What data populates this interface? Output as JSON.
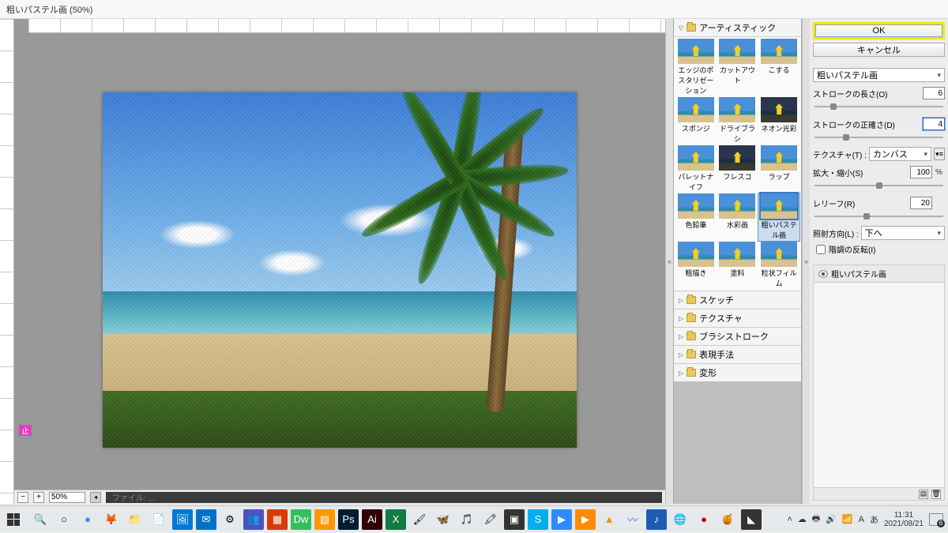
{
  "title": "粗いパステル画 (50%)",
  "zoom": {
    "value": "50%",
    "stop_label": "止"
  },
  "docinfo": "ファイル: ...",
  "categories": {
    "open": "アーティスティック",
    "closed": [
      "スケッチ",
      "テクスチャ",
      "ブラシストローク",
      "表現手法",
      "変形"
    ]
  },
  "thumbs": [
    {
      "label": "エッジのポスタリゼーション",
      "dark": false
    },
    {
      "label": "カットアウト",
      "dark": false
    },
    {
      "label": "こする",
      "dark": false
    },
    {
      "label": "スポンジ",
      "dark": false
    },
    {
      "label": "ドライブラシ",
      "dark": false
    },
    {
      "label": "ネオン光彩",
      "dark": true
    },
    {
      "label": "パレットナイフ",
      "dark": false
    },
    {
      "label": "フレスコ",
      "dark": true
    },
    {
      "label": "ラップ",
      "dark": false
    },
    {
      "label": "色鉛筆",
      "dark": false
    },
    {
      "label": "水彩画",
      "dark": false
    },
    {
      "label": "粗いパステル画",
      "dark": false,
      "selected": true
    },
    {
      "label": "粗描き",
      "dark": false
    },
    {
      "label": "塗料",
      "dark": false
    },
    {
      "label": "粒状フィルム",
      "dark": false
    }
  ],
  "controls": {
    "ok": "OK",
    "cancel": "キャンセル",
    "filter_select": "粗いパステル画",
    "stroke_len_label": "ストロークの長さ(O)",
    "stroke_len_value": "6",
    "stroke_det_label": "ストロークの正確さ(D)",
    "stroke_det_value": "4",
    "texture_label": "テクスチャ(T) :",
    "texture_value": "カンバス",
    "scale_label": "拡大・縮小(S)",
    "scale_value": "100",
    "scale_unit": "%",
    "relief_label": "レリーフ(R)",
    "relief_value": "20",
    "light_label": "照射方向(L) :",
    "light_value": "下へ",
    "invert_label": "階調の反転(I)"
  },
  "layer_label": "粗いパステル画",
  "sys": {
    "time": "11:31",
    "date": "2021/08/21"
  },
  "taskbar_icons": [
    {
      "name": "search-icon",
      "glyph": "🔍",
      "bg": ""
    },
    {
      "name": "cortana-icon",
      "glyph": "○",
      "bg": ""
    },
    {
      "name": "chrome-icon",
      "glyph": "●",
      "bg": "",
      "color": "#4285f4"
    },
    {
      "name": "firefox-icon",
      "glyph": "🦊",
      "bg": ""
    },
    {
      "name": "explorer-icon",
      "glyph": "📁",
      "bg": ""
    },
    {
      "name": "notepad-icon",
      "glyph": "📄",
      "bg": ""
    },
    {
      "name": "photos-icon",
      "glyph": "🖼",
      "bg": "#0078d7"
    },
    {
      "name": "outlook-icon",
      "glyph": "✉",
      "bg": "#0072c6"
    },
    {
      "name": "settings-icon",
      "glyph": "⚙",
      "bg": ""
    },
    {
      "name": "teams-icon",
      "glyph": "👥",
      "bg": "#4b53bc"
    },
    {
      "name": "app-a-icon",
      "glyph": "▦",
      "bg": "#d83b01"
    },
    {
      "name": "dreamweaver-icon",
      "glyph": "Dw",
      "bg": "#35bf5c"
    },
    {
      "name": "sublime-icon",
      "glyph": "▧",
      "bg": "#ff9800"
    },
    {
      "name": "photoshop-icon",
      "glyph": "Ps",
      "bg": "#001d34"
    },
    {
      "name": "illustrator-icon",
      "glyph": "Ai",
      "bg": "#310000"
    },
    {
      "name": "excel-icon",
      "glyph": "X",
      "bg": "#107c41"
    },
    {
      "name": "paint-icon",
      "glyph": "🖌",
      "bg": ""
    },
    {
      "name": "butterfly-icon",
      "glyph": "🦋",
      "bg": ""
    },
    {
      "name": "music-icon",
      "glyph": "🎵",
      "bg": ""
    },
    {
      "name": "brush-icon",
      "glyph": "🖍",
      "bg": ""
    },
    {
      "name": "adobe-icon",
      "glyph": "▣",
      "bg": "#333"
    },
    {
      "name": "skype-icon",
      "glyph": "S",
      "bg": "#00aff0"
    },
    {
      "name": "zoom-icon",
      "glyph": "▶",
      "bg": "#2d8cff"
    },
    {
      "name": "media-icon",
      "glyph": "▶",
      "bg": "#ff8c00"
    },
    {
      "name": "vlc-icon",
      "glyph": "▲",
      "bg": "",
      "color": "#ff8c00"
    },
    {
      "name": "wave-icon",
      "glyph": "〰",
      "bg": "",
      "color": "#7b3fb5"
    },
    {
      "name": "music2-icon",
      "glyph": "♪",
      "bg": "#1e5cb3"
    },
    {
      "name": "globe-icon",
      "glyph": "🌐",
      "bg": "",
      "color": "#1a8a4a"
    },
    {
      "name": "record-icon",
      "glyph": "●",
      "bg": "",
      "color": "#c00000"
    },
    {
      "name": "jar-icon",
      "glyph": "🍯",
      "bg": ""
    },
    {
      "name": "flag-icon",
      "glyph": "◣",
      "bg": "#333"
    }
  ],
  "tray_icons": [
    {
      "name": "tray-up",
      "glyph": "˄"
    },
    {
      "name": "tray-cloud",
      "glyph": "☁"
    },
    {
      "name": "tray-printer",
      "glyph": "🖶"
    },
    {
      "name": "tray-volume",
      "glyph": "🔊"
    },
    {
      "name": "tray-wifi",
      "glyph": "📶"
    },
    {
      "name": "tray-ime",
      "glyph": "A"
    },
    {
      "name": "tray-lang",
      "glyph": "あ"
    }
  ]
}
